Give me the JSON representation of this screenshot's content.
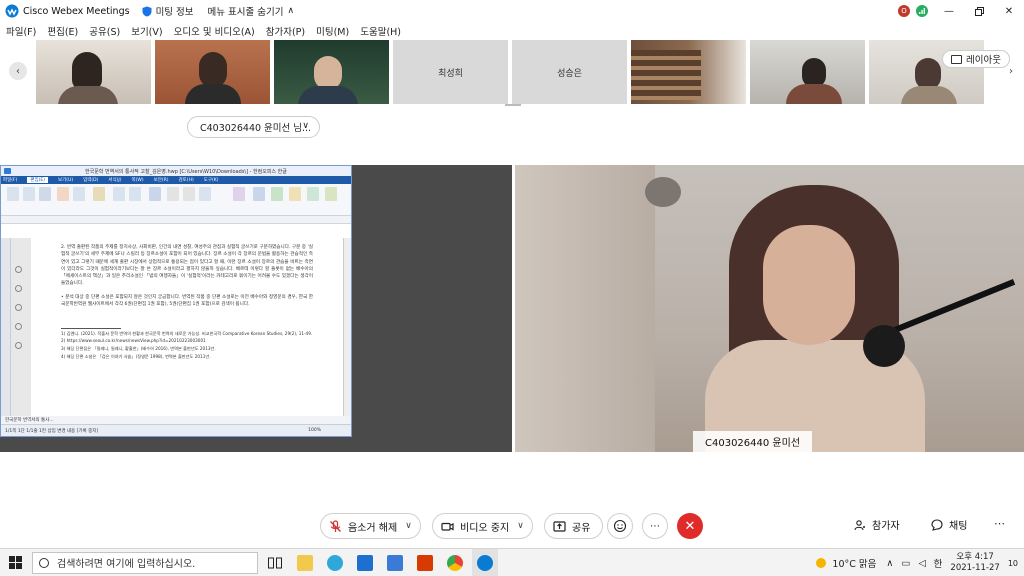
{
  "window": {
    "app_title": "Cisco Webex Meetings",
    "meeting_info": "미팅 정보",
    "hide_menu": "메뉴 표시줄 숨기기",
    "badge_o": "O"
  },
  "menu": [
    "파일(F)",
    "편집(E)",
    "공유(S)",
    "보기(V)",
    "오디오 및 비디오(A)",
    "참가자(P)",
    "미팅(M)",
    "도움말(H)"
  ],
  "thumbnails": {
    "named": [
      {
        "name": "최성희"
      },
      {
        "name": "성승은"
      }
    ],
    "layout_label": "레이아웃"
  },
  "speaker_dropdown": "C403026440 윤미선 님...",
  "shared_doc": {
    "title": "한국문학 번역서의 통사적 고찰_김은영.hwp [C:\\Users\\W10\\Downloads\\] - 한컴오피스 한글",
    "tabs": [
      "파일(F)",
      "편집(E)",
      "보기(U)",
      "입력(D)",
      "서식(J)",
      "쪽(W)",
      "보안(R)",
      "검토(H)",
      "도구(K)"
    ],
    "para1": "2. 번역 출판된 작품의 주제를 정치사상, 사회비판, 인간의 내면 성찰, 여성주의 관점과 실험적 글쓰기로 구분하였습니다. 구분 중 '실험적 글쓰기'의 세부 주제에 SF나 스릴러 등 장르소설이 포함이 되어 있습니다. 장르 소설이 각 장르의 문법을 활용하는 관습적인 측면이 있고 그렇기 때문에 세계 출판 시장에서 상업적으로 통용되는 점이 있다고 할 때, 이런 장르 소설이 장르의 관습을 비트는 측면이 있더라도 그것이 실험적이라기보다는 잘 쓴 장르 소설이라고 평하지 않을까 싶습니다. 베르테 이렇다 할 플롯이 없는 배수아의 「에세이스트의 책상」과 일은 추리소설인 「밤의 여행자들」이 '실험적'이라는 카테고리로 묶이기는 어려울 수도 있겠다는 생각이 들었습니다.",
    "para2": "• 분석 대상 중 단편 소설은 포함되지 않은 것인지 궁금합니다. 번역된 작품 중 단편 소설로는 이전 배수아와 정영문의 경우, 한국 한국문학번역원 웹사이트에서 각각 6권(단편집 1권 포함), 5권(단편집 1권 포함)으로 검색이 됩니다.",
    "footnotes": [
      "1) 김엔니. (2021). 적출서 문학 번역의 현황과 한국문학 번역의 새로운 가능성. 비교한국학 Comparative Korean Studies, 29(2), 11-49.",
      "2) https://www.seoul.co.kr/news/newsView.php?id=20210223003001",
      "3) 해당 단편집은 「밀레니, 밀레니, 황홀한」(배수아 2016), 번역본 출판년도 2013년.",
      "4) 해당 단편 소설은 「검은 이야기 사슬」(정영문 1998), 번역본 출판년도 2011년."
    ],
    "doc_tab": "한국문학 번역서의 통사...",
    "status": "1/1쪽  1단  1/1줄  1칸  삽입  변경 내용 [기록 중지]",
    "zoom": "100%"
  },
  "camera": {
    "name_label": "C403026440 윤미선"
  },
  "controls": {
    "mute": "음소거 해제",
    "video": "비디오 중지",
    "share": "공유",
    "participants": "참가자",
    "chat": "채팅",
    "more": "⋯"
  },
  "taskbar": {
    "search_placeholder": "검색하려면 여기에 입력하십시오.",
    "weather": "10°C 맑음",
    "ime": "한",
    "time": "오후 4:17",
    "date": "2021-11-27",
    "notify_count": "10"
  },
  "colors": {
    "accent_blue": "#1e5aa8",
    "end_red": "#e02b2b"
  }
}
